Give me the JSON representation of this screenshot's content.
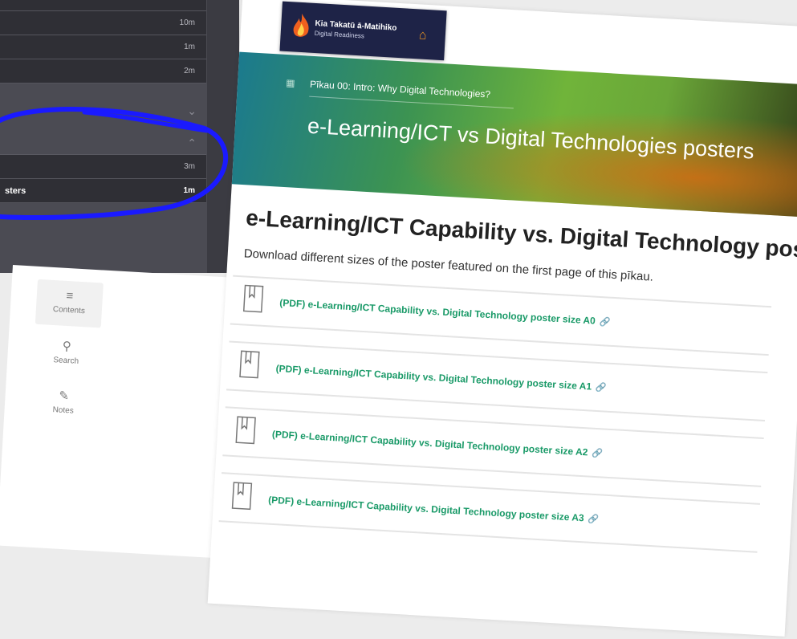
{
  "dark_sidebar": {
    "rows_top": [
      {
        "duration": "10m"
      },
      {
        "duration": "1m"
      },
      {
        "duration": "2m"
      }
    ],
    "rows_bottom": [
      {
        "label": "",
        "duration": "3m"
      },
      {
        "label": "sters",
        "duration": "1m"
      }
    ]
  },
  "logo": {
    "title": "Kia Takatū ā-Matihiko",
    "subtitle": "Digital Readiness"
  },
  "banner": {
    "breadcrumb": "Pīkau 00: Intro: Why Digital Technologies?",
    "title": "e-Learning/ICT vs Digital Technologies posters"
  },
  "main": {
    "heading": "e-Learning/ICT Capability vs. Digital Technology posters",
    "description": "Download different sizes of the poster featured on the first page of this pīkau."
  },
  "files": [
    {
      "label": "(PDF) e-Learning/ICT Capability vs. Digital Technology poster size A0"
    },
    {
      "label": "(PDF) e-Learning/ICT Capability vs. Digital Technology poster size A1"
    },
    {
      "label": "(PDF) e-Learning/ICT Capability vs. Digital Technology poster size A2"
    },
    {
      "label": "(PDF) e-Learning/ICT Capability vs. Digital Technology poster size A3"
    }
  ],
  "nav": {
    "contents": "Contents",
    "search": "Search",
    "notes": "Notes"
  },
  "colors": {
    "accent_green": "#1a9a68",
    "logo_bg": "#1e2347",
    "annotation_blue": "#1a1aff"
  },
  "icons": [
    "menu-icon",
    "search-icon",
    "notes-icon",
    "document-icon",
    "link-icon",
    "home-icon",
    "grid-icon",
    "chevron-down-icon",
    "chevron-up-icon"
  ]
}
